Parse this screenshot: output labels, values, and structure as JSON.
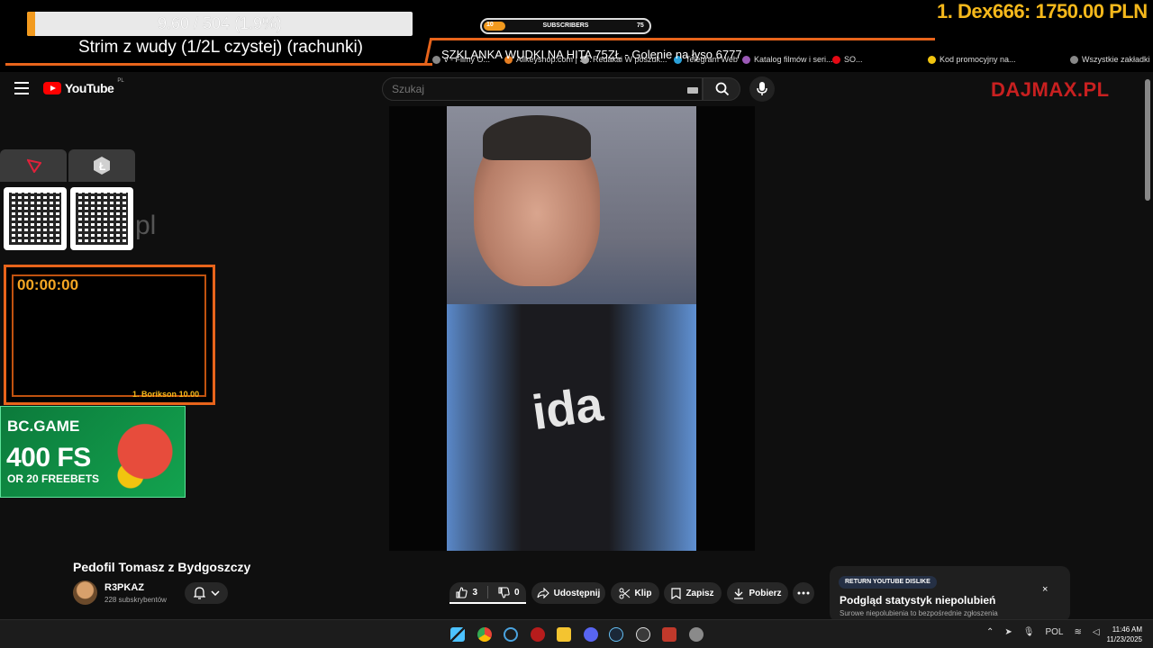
{
  "overlay": {
    "goal_text": "9.60 / 504 (1.9%)",
    "goal_progress": 0.019,
    "stream_title": "Strim z wudy (1/2L czystej) (rachunki)",
    "subscribers": {
      "label": "SUBSCRIBERS",
      "current": "10",
      "max": "75",
      "progress": 0.13
    },
    "top_donor": {
      "rank": "1.",
      "name": "Dex666:",
      "amount": "1750.00 PLN"
    },
    "ticker": "SZKLANKA WUDKI NA HITA 75ZŁ - Golenie na łyso 6777",
    "timer": "00:00:00",
    "timer_donor": {
      "rank": "1.",
      "name": "Borikson",
      "amount": "10.00"
    },
    "partial_text": "pl",
    "brand_watermark": "DAJMAX.PL",
    "bc_banner": {
      "logo": "BC.GAME",
      "offer": "400 FS",
      "sub": "OR 20 FREEBETS"
    }
  },
  "bookmarks": [
    {
      "label": "v - Filmy O...",
      "color": "#888888"
    },
    {
      "label": "Allkeyshop.com | S...",
      "color": "#e67e22"
    },
    {
      "label": "Redakai W poszuk...",
      "color": "#aaaaaa"
    },
    {
      "label": "Telegram Web",
      "color": "#2aa1da"
    },
    {
      "label": "Katalog filmów i seri...",
      "color": "#9b59b6"
    },
    {
      "label": "SO...",
      "color": "#e50914"
    },
    {
      "label": "Kod promocyjny na...",
      "color": "#f1c40f"
    },
    {
      "label": "Wszystkie zakładki",
      "color": "#888888"
    }
  ],
  "youtube": {
    "logo_text": "YouTube",
    "region": "PL",
    "search_placeholder": "Szukaj",
    "video_title": "Pedofil Tomasz z Bydgoszczy",
    "channel_name": "R3PKAZ",
    "channel_subs": "228 subskrybentów",
    "likes": "3",
    "dislikes": "0",
    "share_label": "Udostępnij",
    "clip_label": "Klip",
    "save_label": "Zapisz",
    "download_label": "Pobierz",
    "video_overlay_text": "ida"
  },
  "dislike_card": {
    "badge": "RETURN YOUTUBE DISLIKE",
    "title": "Podgląd statystyk niepolubień",
    "desc": "Surowe niepolubienia to bezpośrednie zgłoszenia",
    "close": "×"
  },
  "taskbar": {
    "language": "POL",
    "time": "11:46 AM",
    "date": "11/23/2025"
  },
  "colors": {
    "accent_orange": "#e8641b",
    "gold": "#f5b81b",
    "yt_red": "#ff0000",
    "bc_green": "#13a34f"
  }
}
